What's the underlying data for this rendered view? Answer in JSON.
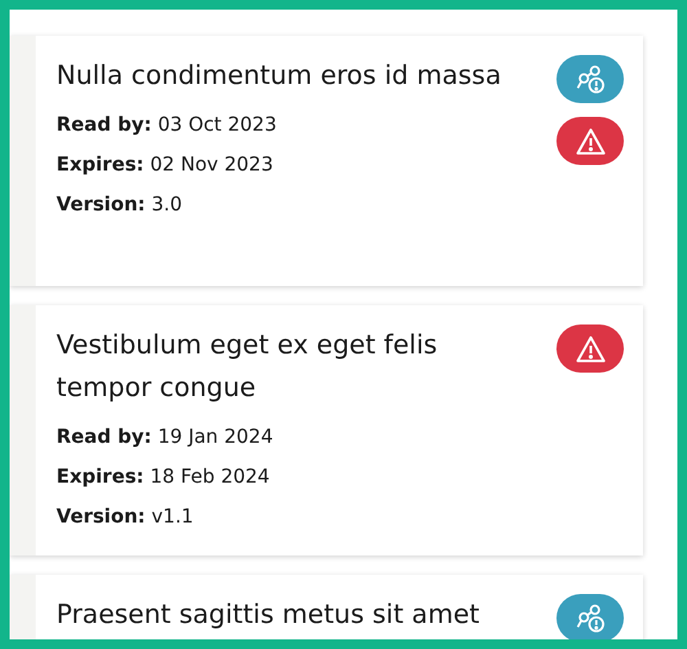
{
  "cards": [
    {
      "title": "Nulla condimentum eros id massa",
      "fields": [
        {
          "label": "Read by:",
          "value": "03 Oct 2023"
        },
        {
          "label": "Expires:",
          "value": "02 Nov 2023"
        },
        {
          "label": "Version:",
          "value": "3.0"
        }
      ],
      "badges": [
        {
          "kind": "workflow"
        },
        {
          "kind": "warning"
        }
      ]
    },
    {
      "title": "Vestibulum eget ex eget felis tempor congue",
      "fields": [
        {
          "label": "Read by:",
          "value": "19 Jan 2024"
        },
        {
          "label": "Expires:",
          "value": "18 Feb 2024"
        },
        {
          "label": "Version:",
          "value": "v1.1"
        }
      ],
      "badges": [
        {
          "kind": "warning"
        }
      ]
    },
    {
      "title": "Praesent sagittis metus sit amet",
      "badges": [
        {
          "kind": "workflow"
        }
      ]
    }
  ]
}
